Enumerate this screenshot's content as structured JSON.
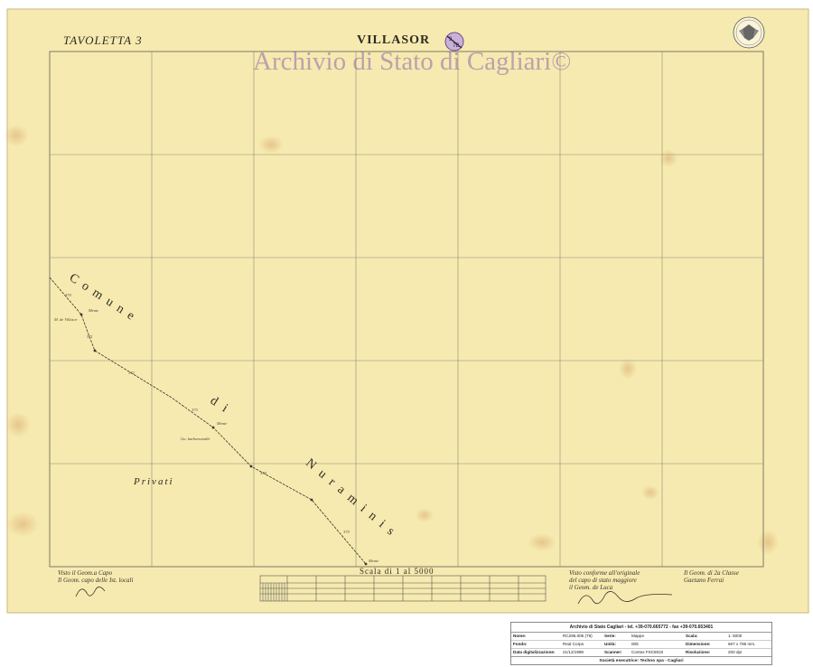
{
  "map": {
    "sheet_label": "TAVOLETTA 3",
    "place_name": "VILLASOR",
    "watermark": "Archivio di Stato di Cagliari©",
    "boundary_words": [
      "Comune",
      "di",
      "Nuraminis"
    ],
    "area_label": "Privati",
    "scale_label": "Scala di 1 al 5000",
    "colors": {
      "paper": "#f6eab0",
      "ink": "#2f2a22",
      "watermark": "#8c64aa",
      "grid": "#8e8a78"
    },
    "icons": [
      "seal-icon",
      "stamp-icon"
    ]
  },
  "notes": {
    "left": [
      "Visto il Geom.a Capo",
      "Il Geom. capo delle Ist. locali"
    ],
    "right_a": [
      "Visto conforme all'originale",
      "del capo di stato maggiore",
      "il Geom. de Luca"
    ],
    "right_b": [
      "Il Geom. di 2a Classe",
      "Gaetano Ferrai"
    ]
  },
  "info_table": {
    "header": "Archivio di Stato Cagliari - tel. +39-070.665772 - fax +39-070.653401",
    "rows": [
      [
        {
          "key": "Nome:",
          "value": "RC295.005 (78)"
        },
        {
          "key": "Serie:",
          "value": "Mappe"
        },
        {
          "key": "Scala:",
          "value": "1: 5000"
        }
      ],
      [
        {
          "key": "Fondo:",
          "value": "Real Corpo"
        },
        {
          "key": "Unità:",
          "value": "005"
        },
        {
          "key": "Dimensione:",
          "value": "667 x 786 mm."
        }
      ],
      [
        {
          "key": "Data digitalizzazione:",
          "value": "21/12/1998"
        },
        {
          "key": "Scanner:",
          "value": "Contex FSC8010"
        },
        {
          "key": "Risoluzione:",
          "value": "200 dpi"
        }
      ]
    ],
    "footer": "Società esecutrice: Techno spa - Cagliari"
  }
}
